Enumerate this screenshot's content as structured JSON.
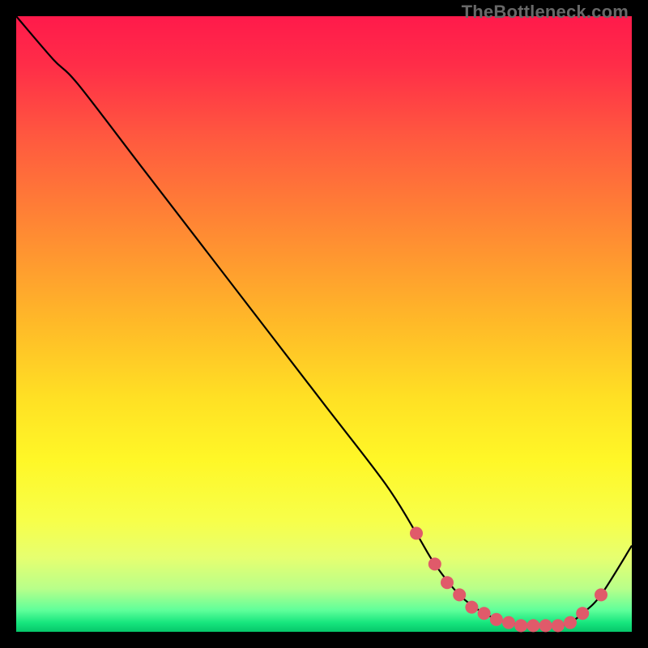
{
  "watermark": "TheBottleneck.com",
  "chart_data": {
    "type": "line",
    "title": "",
    "xlabel": "",
    "ylabel": "",
    "xlim": [
      0,
      100
    ],
    "ylim": [
      0,
      100
    ],
    "x": [
      0,
      6,
      10,
      20,
      30,
      40,
      50,
      60,
      65,
      68,
      72,
      76,
      80,
      84,
      88,
      90,
      92,
      95,
      100
    ],
    "y": [
      100,
      93,
      89,
      76,
      63,
      50,
      37,
      24,
      16,
      11,
      6,
      3,
      1.5,
      1,
      1,
      1.5,
      3,
      6,
      14
    ],
    "markers": {
      "x": [
        65,
        68,
        70,
        72,
        74,
        76,
        78,
        80,
        82,
        84,
        86,
        88,
        90,
        92,
        95
      ],
      "y": [
        16,
        11,
        8,
        6,
        4,
        3,
        2,
        1.5,
        1,
        1,
        1,
        1,
        1.5,
        3,
        6
      ]
    },
    "gradient_stops": [
      {
        "pos": 0.0,
        "color": "#ff1a4b"
      },
      {
        "pos": 0.08,
        "color": "#ff2d48"
      },
      {
        "pos": 0.2,
        "color": "#ff5a3f"
      },
      {
        "pos": 0.35,
        "color": "#ff8a33"
      },
      {
        "pos": 0.5,
        "color": "#ffba28"
      },
      {
        "pos": 0.62,
        "color": "#ffe024"
      },
      {
        "pos": 0.72,
        "color": "#fff727"
      },
      {
        "pos": 0.82,
        "color": "#f7ff4a"
      },
      {
        "pos": 0.88,
        "color": "#e6ff70"
      },
      {
        "pos": 0.93,
        "color": "#b8ff8a"
      },
      {
        "pos": 0.965,
        "color": "#5fff9a"
      },
      {
        "pos": 0.985,
        "color": "#17e67e"
      },
      {
        "pos": 1.0,
        "color": "#06c76a"
      }
    ],
    "curve_stroke": "#000000",
    "marker_color": "#e05a6a",
    "marker_radius": 8
  }
}
